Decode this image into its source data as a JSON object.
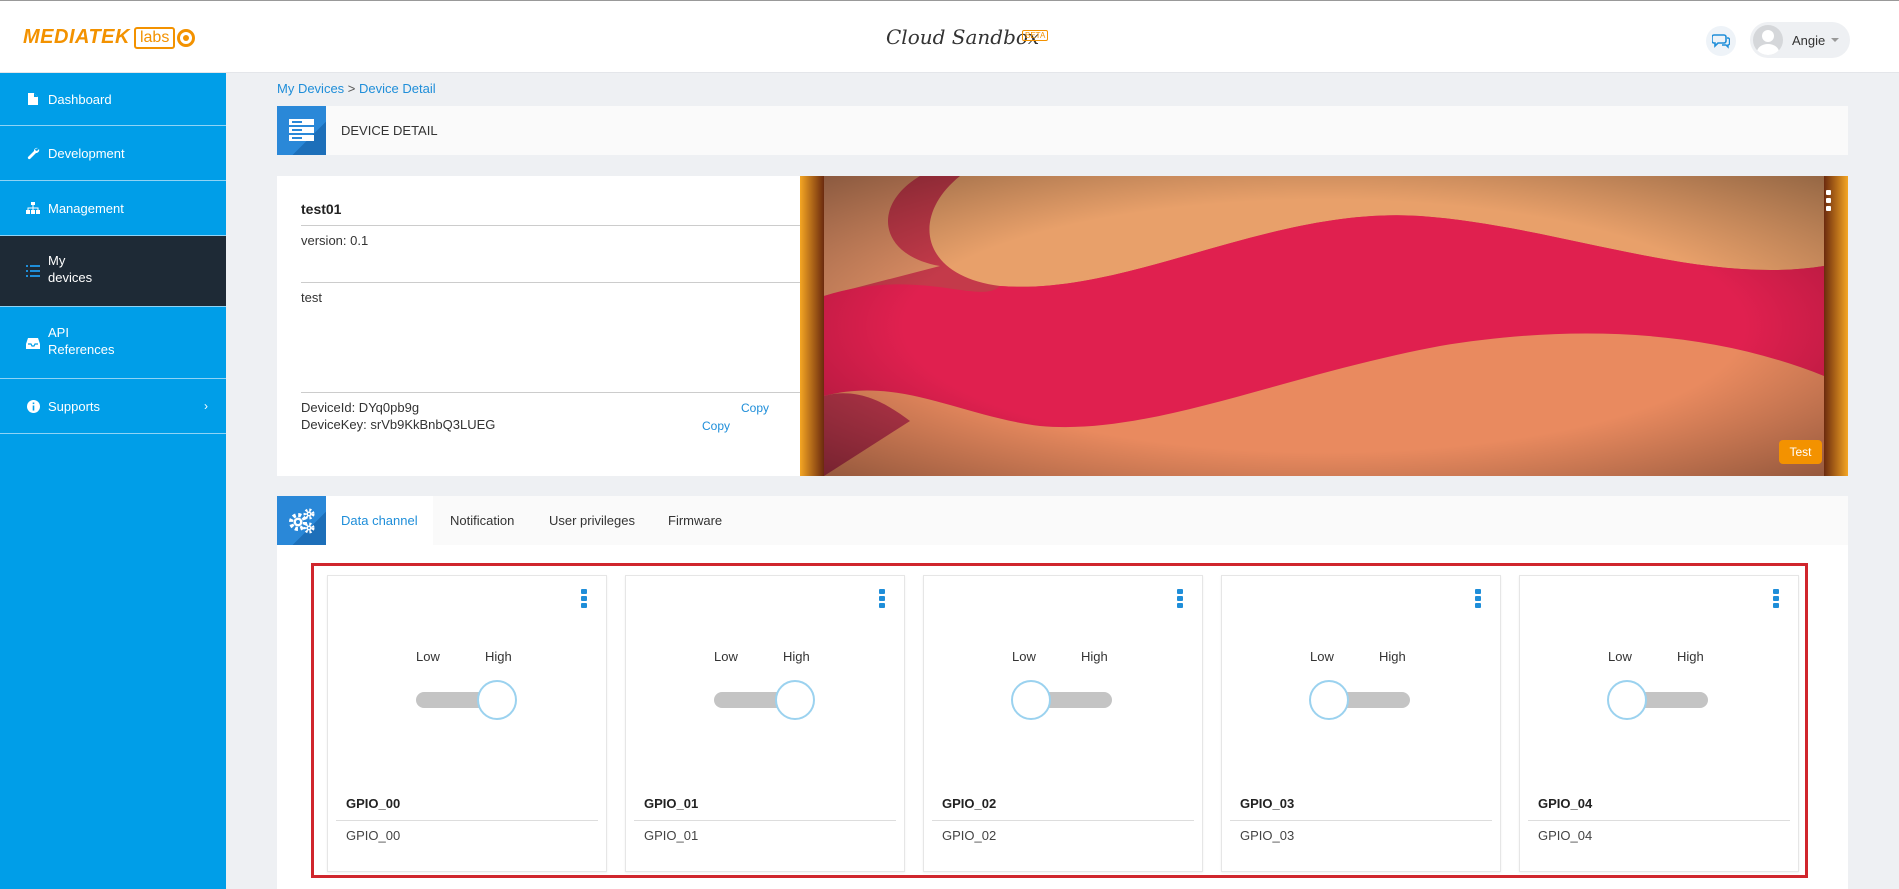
{
  "brand": {
    "word": "MEDIATEK",
    "labs": "labs"
  },
  "app": {
    "title": "Cloud Sandbox",
    "badge": "BETA"
  },
  "user": {
    "name": "Angie"
  },
  "sidebar": {
    "items": [
      {
        "label": "Dashboard",
        "icon": "file-icon"
      },
      {
        "label": "Development",
        "icon": "wrench-icon"
      },
      {
        "label": "Management",
        "icon": "sitemap-icon"
      },
      {
        "label_line1": "My",
        "label_line2": "devices",
        "icon": "list-icon",
        "active": true
      },
      {
        "label_line1": "API",
        "label_line2": "References",
        "icon": "inbox-icon"
      },
      {
        "label": "Supports",
        "icon": "info-icon",
        "chevron": "›"
      }
    ]
  },
  "breadcrumb": {
    "parent": "My Devices",
    "separator": " > ",
    "current": "Device Detail"
  },
  "detail": {
    "title": "DEVICE DETAIL"
  },
  "device": {
    "name": "test01",
    "version": "version: 0.1",
    "description": "test",
    "id_label": "DeviceId: DYq0pb9g",
    "key_label": "DeviceKey: srVb9KkBnbQ3LUEG",
    "copy_id": "Copy",
    "copy_key": "Copy",
    "test_button": "Test"
  },
  "tabs": [
    "Data channel",
    "Notification",
    "User privileges",
    "Firmware"
  ],
  "channels": [
    {
      "name": "GPIO_00",
      "desc": "GPIO_00",
      "low": "Low",
      "high": "High",
      "state": "High"
    },
    {
      "name": "GPIO_01",
      "desc": "GPIO_01",
      "low": "Low",
      "high": "High",
      "state": "High"
    },
    {
      "name": "GPIO_02",
      "desc": "GPIO_02",
      "low": "Low",
      "high": "High",
      "state": "Low"
    },
    {
      "name": "GPIO_03",
      "desc": "GPIO_03",
      "low": "Low",
      "high": "High",
      "state": "Low"
    },
    {
      "name": "GPIO_04",
      "desc": "GPIO_04",
      "low": "Low",
      "high": "High",
      "state": "Low"
    }
  ],
  "colors": {
    "sidebar": "#009ee8",
    "active": "#1e2a36",
    "accent": "#f39200",
    "link": "#1f8ed9",
    "highlight": "#d0262d"
  }
}
